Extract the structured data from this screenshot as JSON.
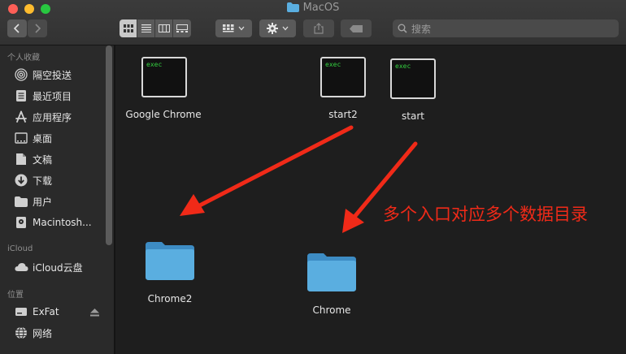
{
  "window": {
    "title": "MacOS"
  },
  "toolbar": {
    "search_placeholder": "搜索"
  },
  "sidebar": {
    "favorites_header": "个人收藏",
    "favorites": [
      {
        "label": "隔空投送",
        "icon": "airdrop-icon"
      },
      {
        "label": "最近项目",
        "icon": "recents-icon"
      },
      {
        "label": "应用程序",
        "icon": "applications-icon"
      },
      {
        "label": "桌面",
        "icon": "desktop-icon"
      },
      {
        "label": "文稿",
        "icon": "documents-icon"
      },
      {
        "label": "下载",
        "icon": "downloads-icon"
      },
      {
        "label": "用户",
        "icon": "folder-icon"
      },
      {
        "label": "Macintosh...",
        "icon": "disk-icon"
      }
    ],
    "icloud_header": "iCloud",
    "icloud": [
      {
        "label": "iCloud云盘",
        "icon": "cloud-icon"
      }
    ],
    "locations_header": "位置",
    "locations": [
      {
        "label": "ExFat",
        "icon": "drive-icon"
      },
      {
        "label": "网络",
        "icon": "network-icon"
      }
    ]
  },
  "files": {
    "exec_badge": "exec",
    "google_chrome": "Google Chrome",
    "start2": "start2",
    "start": "start",
    "chrome2": "Chrome2",
    "chrome": "Chrome"
  },
  "annotation": {
    "text": "多个入口对应多个数据目录",
    "color": "#f02a18"
  },
  "colors": {
    "folder": "#5aaee0",
    "exec_text": "#34d040"
  }
}
